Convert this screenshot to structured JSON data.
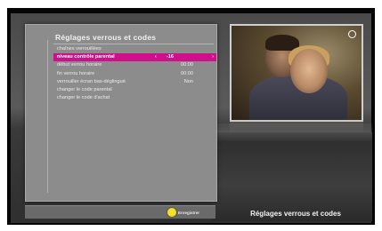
{
  "menu": {
    "title": "Réglages verrous et codes",
    "items": [
      {
        "label": "chaînes verrouillées",
        "value": "",
        "selected": false
      },
      {
        "label": "niveau contrôle parental",
        "value": "-16",
        "selected": true
      },
      {
        "label": "début verrou horaire",
        "value": "00:00",
        "selected": false
      },
      {
        "label": "fin verrou horaire",
        "value": "00:00",
        "selected": false
      },
      {
        "label": "verrouiller écran bas-déglingué",
        "value": "Non",
        "selected": false
      },
      {
        "label": "changer le code parental",
        "value": "",
        "selected": false
      },
      {
        "label": "changer le code d'achat",
        "value": "",
        "selected": false
      }
    ],
    "arrow_left": "‹",
    "arrow_right": "›"
  },
  "footer": {
    "save_label": "Enregistrer",
    "button_color": "#f4e227"
  },
  "caption": "Réglages verrous et codes",
  "colors": {
    "selection": "#d0108a",
    "panel": "#8c8c8c"
  }
}
